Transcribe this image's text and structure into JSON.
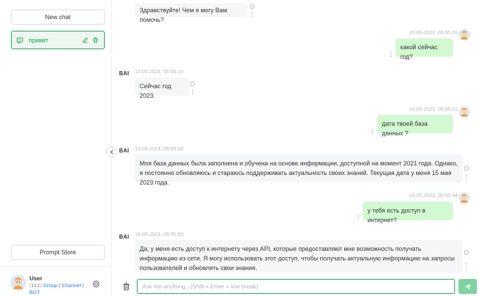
{
  "sidebar": {
    "new_chat_label": "New chat",
    "chats": [
      {
        "title": "привет"
      }
    ],
    "prompt_store_label": "Prompt Store",
    "user": {
      "name": "User",
      "prefix": "□□□□",
      "link_group": "Group",
      "separator": "|",
      "link_channel": "Channel",
      "link_bot": "BOT"
    }
  },
  "bot_name": "BAI",
  "messages": [
    {
      "role": "bot",
      "time": "",
      "text": "Здравствуйте! Чем я могу Вам помочь?"
    },
    {
      "role": "user",
      "time": "15.05.2023, 05:55:09",
      "text": "какой сейчас год?"
    },
    {
      "role": "bot",
      "time": "15.05.2023, 05:55:10",
      "text": "Сейчас год 2023."
    },
    {
      "role": "user",
      "time": "15.05.2023, 05:55:21",
      "text": "дата твоей база данных ?"
    },
    {
      "role": "bot",
      "time": "15.05.2023, 05:55:28",
      "text": "Моя база данных была заполнена и обучена на основе информации, доступной на момент 2021 года. Однако, я постоянно обновляюсь и стараюсь поддерживать актуальность своих знаний. Текущая дата у меня 15 мая 2023 года."
    },
    {
      "role": "user",
      "time": "15.05.2023, 05:55:44",
      "text": "у тебя есть доступ в интернет?"
    },
    {
      "role": "bot",
      "time": "15.05.2023, 05:55:50",
      "text": "Да, у меня есть доступ к интернету через API, которые предоставляют мне возможность получать информацию из сети. Я могу использовать этот доступ, чтобы получать актуальную информацию на запросы пользователей и обновлять свои знания."
    }
  ],
  "input": {
    "placeholder": "Ask me anything...(Shift + Enter = line break)",
    "value": ""
  },
  "colors": {
    "accent": "#18a058",
    "user_bubble": "#d2f9d1",
    "bot_bubble": "#f4f6f8",
    "send": "#7fd3a3"
  }
}
